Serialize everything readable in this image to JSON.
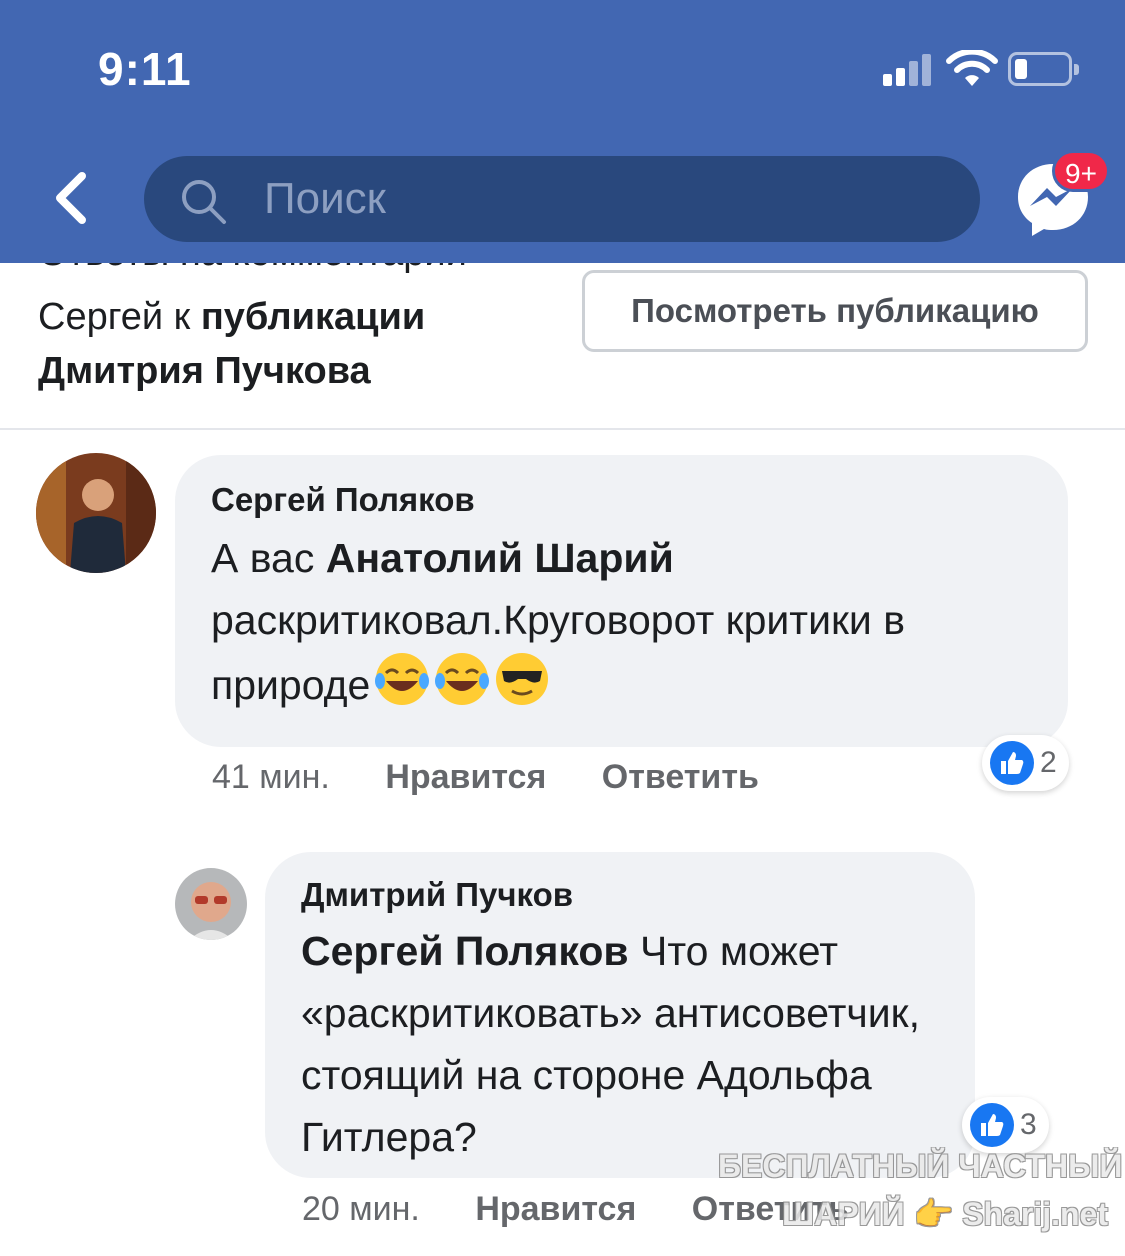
{
  "status_bar": {
    "time": "9:11"
  },
  "header": {
    "search_placeholder": "Поиск",
    "messenger_badge": "9+"
  },
  "post_context": {
    "cut_text": "Ответы на комментарии",
    "prefix": "Сергей к ",
    "bold": "публикации Дмитрия Пучкова",
    "view_button": "Посмотреть публикацию"
  },
  "comments": [
    {
      "author": "Сергей Поляков",
      "text_prefix": "А вас ",
      "mention": "Анатолий Шарий",
      "text_rest": " раскритиковал.Круговорот критики в природе",
      "emojis": [
        "tears-of-joy",
        "tears-of-joy",
        "sunglasses"
      ],
      "time": "41 мин.",
      "like_label": "Нравится",
      "reply_label": "Ответить",
      "reaction_count": "2"
    },
    {
      "author": "Дмитрий Пучков",
      "mention": "Сергей Поляков",
      "text_rest": " Что может «раскритиковать» антисоветчик, стоящий на стороне Адольфа Гитлера?",
      "time": "20 мин.",
      "like_label": "Нравится",
      "reply_label": "Ответить",
      "reaction_count": "3"
    }
  ],
  "watermark": {
    "line1": "БЕСПЛАТНЫЙ ЧАСТНЫЙ",
    "line2": "ШАРИЙ 👉 Sharij.net"
  },
  "colors": {
    "header": "#4267b2",
    "search": "#29487d",
    "bubble": "#f0f2f5",
    "like": "#1877f2",
    "badge": "#f02849"
  }
}
